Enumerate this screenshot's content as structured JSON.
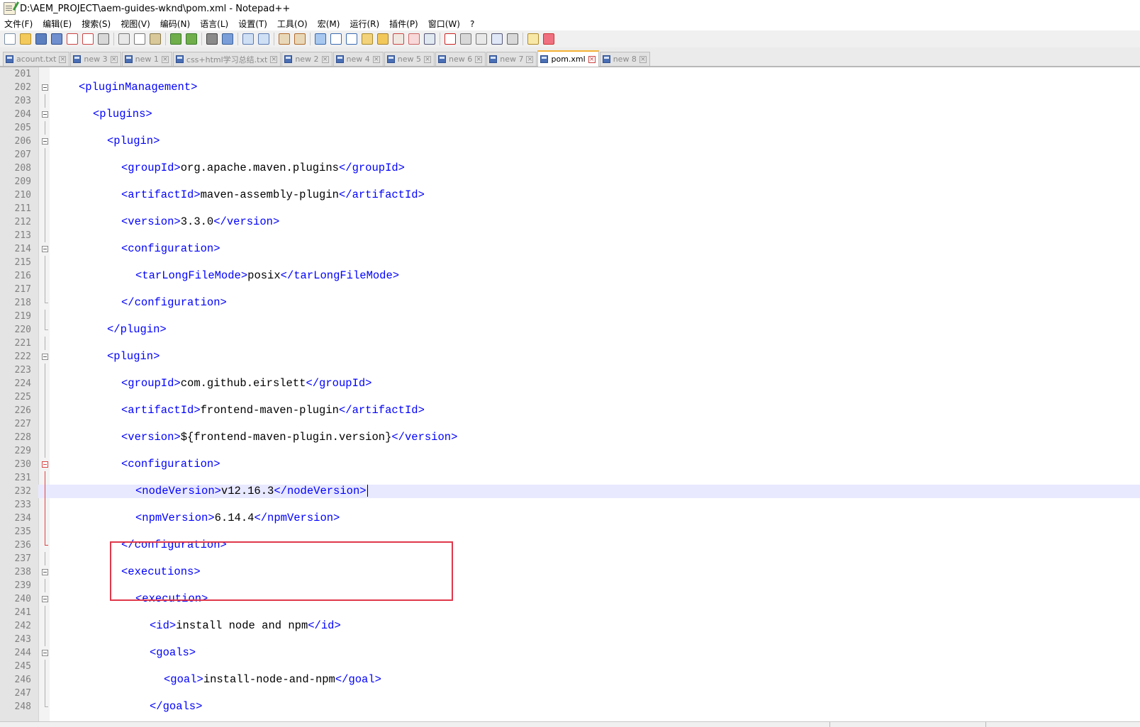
{
  "window": {
    "title": "D:\\AEM_PROJECT\\aem-guides-wknd\\pom.xml - Notepad++"
  },
  "menu": [
    "文件(F)",
    "编辑(E)",
    "搜索(S)",
    "视图(V)",
    "编码(N)",
    "语言(L)",
    "设置(T)",
    "工具(O)",
    "宏(M)",
    "运行(R)",
    "插件(P)",
    "窗口(W)",
    "?"
  ],
  "toolbar": {
    "icons": [
      {
        "name": "new-file-icon",
        "color": "#ffffff",
        "border": "#7a8fa8"
      },
      {
        "name": "open-file-icon",
        "color": "#f2c95a",
        "border": "#b8902a"
      },
      {
        "name": "save-icon",
        "color": "#5b7fbf",
        "border": "#2f4f8f"
      },
      {
        "name": "save-all-icon",
        "color": "#6f8fcf",
        "border": "#2f4f8f"
      },
      {
        "name": "close-icon",
        "color": "#ffffff",
        "border": "#c44"
      },
      {
        "name": "close-all-icon",
        "color": "#ffffff",
        "border": "#c44"
      },
      {
        "name": "print-icon",
        "color": "#d8d8d8",
        "border": "#666"
      },
      {
        "sep": true
      },
      {
        "name": "cut-icon",
        "color": "#e8e8e8",
        "border": "#777"
      },
      {
        "name": "copy-icon",
        "color": "#ffffff",
        "border": "#777"
      },
      {
        "name": "paste-icon",
        "color": "#d8c89a",
        "border": "#8a7a4a"
      },
      {
        "sep": true
      },
      {
        "name": "undo-icon",
        "color": "#6fae4a",
        "border": "#3a7a2a"
      },
      {
        "name": "redo-icon",
        "color": "#6fae4a",
        "border": "#3a7a2a"
      },
      {
        "sep": true
      },
      {
        "name": "find-icon",
        "color": "#8a8a8a",
        "border": "#444"
      },
      {
        "name": "replace-icon",
        "color": "#7a9fd8",
        "border": "#3a5f98"
      },
      {
        "sep": true
      },
      {
        "name": "zoom-in-icon",
        "color": "#cfe0f5",
        "border": "#5a7ab0"
      },
      {
        "name": "zoom-out-icon",
        "color": "#cfe0f5",
        "border": "#5a7ab0"
      },
      {
        "sep": true
      },
      {
        "name": "sync-vertical-icon",
        "color": "#e8d8b8",
        "border": "#b06a2a"
      },
      {
        "name": "sync-horizontal-icon",
        "color": "#e8d8b8",
        "border": "#b06a2a"
      },
      {
        "sep": true
      },
      {
        "name": "word-wrap-icon",
        "color": "#a8c8f0",
        "border": "#3a6ab0"
      },
      {
        "name": "show-all-chars-icon",
        "color": "#ffffff",
        "border": "#3a6ab0"
      },
      {
        "name": "indent-guide-icon",
        "color": "#ffffff",
        "border": "#3a6ab0"
      },
      {
        "name": "user-lang-icon",
        "color": "#f2d27a",
        "border": "#a88a2a"
      },
      {
        "name": "doc-map-icon",
        "color": "#f2c85a",
        "border": "#a8802a"
      },
      {
        "name": "function-list-icon",
        "color": "#f0e8e0",
        "border": "#c44"
      },
      {
        "name": "folder-workspace-icon",
        "color": "#f8d8d8",
        "border": "#c66"
      },
      {
        "name": "monitoring-icon",
        "color": "#e0e8f0",
        "border": "#557"
      },
      {
        "sep": true
      },
      {
        "name": "record-macro-icon",
        "color": "#ffffff",
        "border": "#c22"
      },
      {
        "name": "stop-record-icon",
        "color": "#d8d8d8",
        "border": "#777"
      },
      {
        "name": "play-macro-icon",
        "color": "#e8e8e8",
        "border": "#777"
      },
      {
        "name": "run-macro-multiple-icon",
        "color": "#e0e8f8",
        "border": "#557"
      },
      {
        "name": "save-macro-icon",
        "color": "#d8d8d8",
        "border": "#666"
      },
      {
        "sep": true
      },
      {
        "name": "translate-icon",
        "color": "#f8e8a8",
        "border": "#b08a2a"
      },
      {
        "name": "heart-icon",
        "color": "#f07080",
        "border": "#c33"
      }
    ]
  },
  "tabs": [
    {
      "label": "acount.txt",
      "active": false
    },
    {
      "label": "new 3",
      "active": false
    },
    {
      "label": "new 1",
      "active": false
    },
    {
      "label": "css+html学习总结.txt",
      "active": false
    },
    {
      "label": "new 2",
      "active": false
    },
    {
      "label": "new 4",
      "active": false
    },
    {
      "label": "new 5",
      "active": false
    },
    {
      "label": "new 6",
      "active": false
    },
    {
      "label": "new 7",
      "active": false
    },
    {
      "label": "pom.xml",
      "active": true
    },
    {
      "label": "new 8",
      "active": false
    }
  ],
  "editor": {
    "current_line": 232,
    "lines": [
      {
        "n": "201",
        "parts": []
      },
      {
        "n": "202",
        "fold": "box",
        "parts": [
          [
            "tag",
            "<pluginManagement>"
          ]
        ],
        "indent": 0
      },
      {
        "n": "203",
        "fold": "line",
        "parts": []
      },
      {
        "n": "204",
        "fold": "box",
        "parts": [
          [
            "tag",
            "<plugins>"
          ]
        ],
        "indent": 1
      },
      {
        "n": "205",
        "fold": "line",
        "parts": []
      },
      {
        "n": "206",
        "fold": "box",
        "parts": [
          [
            "tag",
            "<plugin>"
          ]
        ],
        "indent": 2
      },
      {
        "n": "207",
        "fold": "line",
        "parts": []
      },
      {
        "n": "208",
        "fold": "line",
        "parts": [
          [
            "tag",
            "<groupId>"
          ],
          [
            "txt",
            "org.apache.maven.plugins"
          ],
          [
            "tag",
            "</groupId>"
          ]
        ],
        "indent": 3
      },
      {
        "n": "209",
        "fold": "line",
        "parts": []
      },
      {
        "n": "210",
        "fold": "line",
        "parts": [
          [
            "tag",
            "<artifactId>"
          ],
          [
            "txt",
            "maven-assembly-plugin"
          ],
          [
            "tag",
            "</artifactId>"
          ]
        ],
        "indent": 3
      },
      {
        "n": "211",
        "fold": "line",
        "parts": []
      },
      {
        "n": "212",
        "fold": "line",
        "parts": [
          [
            "tag",
            "<version>"
          ],
          [
            "txt",
            "3.3.0"
          ],
          [
            "tag",
            "</version>"
          ]
        ],
        "indent": 3
      },
      {
        "n": "213",
        "fold": "line",
        "parts": []
      },
      {
        "n": "214",
        "fold": "box",
        "parts": [
          [
            "tag",
            "<configuration>"
          ]
        ],
        "indent": 3
      },
      {
        "n": "215",
        "fold": "line",
        "parts": []
      },
      {
        "n": "216",
        "fold": "line",
        "parts": [
          [
            "tag",
            "<tarLongFileMode>"
          ],
          [
            "txt",
            "posix"
          ],
          [
            "tag",
            "</tarLongFileMode>"
          ]
        ],
        "indent": 4
      },
      {
        "n": "217",
        "fold": "line",
        "parts": []
      },
      {
        "n": "218",
        "fold": "end",
        "parts": [
          [
            "tag",
            "</configuration>"
          ]
        ],
        "indent": 3
      },
      {
        "n": "219",
        "fold": "line",
        "parts": []
      },
      {
        "n": "220",
        "fold": "end",
        "parts": [
          [
            "tag",
            "</plugin>"
          ]
        ],
        "indent": 2
      },
      {
        "n": "221",
        "fold": "line",
        "parts": []
      },
      {
        "n": "222",
        "fold": "box",
        "parts": [
          [
            "tag",
            "<plugin>"
          ]
        ],
        "indent": 2
      },
      {
        "n": "223",
        "fold": "line",
        "parts": []
      },
      {
        "n": "224",
        "fold": "line",
        "parts": [
          [
            "tag",
            "<groupId>"
          ],
          [
            "txt",
            "com.github.eirslett"
          ],
          [
            "tag",
            "</groupId>"
          ]
        ],
        "indent": 3
      },
      {
        "n": "225",
        "fold": "line",
        "parts": []
      },
      {
        "n": "226",
        "fold": "line",
        "parts": [
          [
            "tag",
            "<artifactId>"
          ],
          [
            "txt",
            "frontend-maven-plugin"
          ],
          [
            "tag",
            "</artifactId>"
          ]
        ],
        "indent": 3
      },
      {
        "n": "227",
        "fold": "line",
        "parts": []
      },
      {
        "n": "228",
        "fold": "line",
        "parts": [
          [
            "tag",
            "<version>"
          ],
          [
            "txt",
            "${frontend-maven-plugin.version}"
          ],
          [
            "tag",
            "</version>"
          ]
        ],
        "indent": 3
      },
      {
        "n": "229",
        "fold": "line",
        "parts": []
      },
      {
        "n": "230",
        "fold": "box-red",
        "parts": [
          [
            "tag",
            "<configuration>"
          ]
        ],
        "indent": 3
      },
      {
        "n": "231",
        "fold": "line-red",
        "parts": []
      },
      {
        "n": "232",
        "fold": "line-red",
        "parts": [
          [
            "tag",
            "<nodeVersion>"
          ],
          [
            "txt",
            "v12.16.3"
          ],
          [
            "tag",
            "</nodeVersion>"
          ]
        ],
        "indent": 4,
        "caret": true
      },
      {
        "n": "233",
        "fold": "line-red",
        "parts": []
      },
      {
        "n": "234",
        "fold": "line-red",
        "parts": [
          [
            "tag",
            "<npmVersion>"
          ],
          [
            "txt",
            "6.14.4"
          ],
          [
            "tag",
            "</npmVersion>"
          ]
        ],
        "indent": 4
      },
      {
        "n": "235",
        "fold": "line-red",
        "parts": []
      },
      {
        "n": "236",
        "fold": "end-red",
        "parts": [
          [
            "tag",
            "</configuration>"
          ]
        ],
        "indent": 3
      },
      {
        "n": "237",
        "fold": "line",
        "parts": []
      },
      {
        "n": "238",
        "fold": "box",
        "parts": [
          [
            "tag",
            "<executions>"
          ]
        ],
        "indent": 3
      },
      {
        "n": "239",
        "fold": "line",
        "parts": []
      },
      {
        "n": "240",
        "fold": "box",
        "parts": [
          [
            "tag",
            "<execution>"
          ]
        ],
        "indent": 4
      },
      {
        "n": "241",
        "fold": "line",
        "parts": []
      },
      {
        "n": "242",
        "fold": "line",
        "parts": [
          [
            "tag",
            "<id>"
          ],
          [
            "txt",
            "install node and npm"
          ],
          [
            "tag",
            "</id>"
          ]
        ],
        "indent": 5
      },
      {
        "n": "243",
        "fold": "line",
        "parts": []
      },
      {
        "n": "244",
        "fold": "box",
        "parts": [
          [
            "tag",
            "<goals>"
          ]
        ],
        "indent": 5
      },
      {
        "n": "245",
        "fold": "line",
        "parts": []
      },
      {
        "n": "246",
        "fold": "line",
        "parts": [
          [
            "tag",
            "<goal>"
          ],
          [
            "txt",
            "install-node-and-npm"
          ],
          [
            "tag",
            "</goal>"
          ]
        ],
        "indent": 6
      },
      {
        "n": "247",
        "fold": "line",
        "parts": []
      },
      {
        "n": "248",
        "fold": "end",
        "parts": [
          [
            "tag",
            "</goals>"
          ]
        ],
        "indent": 5
      }
    ]
  },
  "colors": {
    "tag": "#0000ff",
    "text": "#000000",
    "current_line": "#e8e8ff",
    "highlight_box": "#e0374a",
    "active_tab_accent": "#f5b234"
  }
}
